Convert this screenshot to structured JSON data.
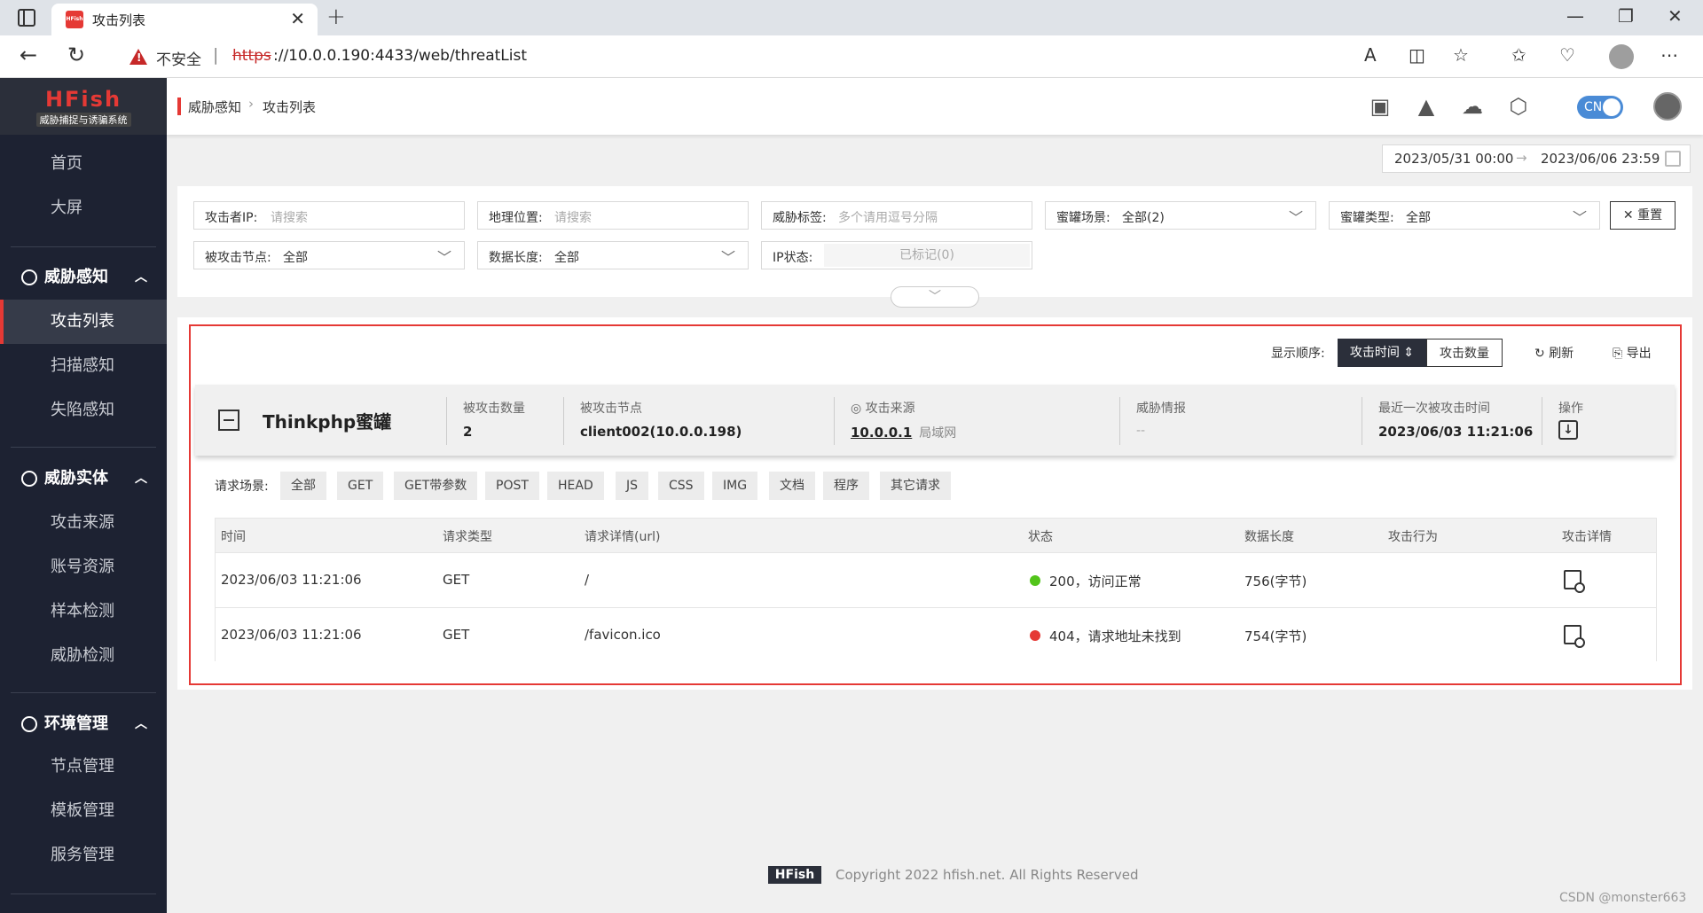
{
  "browser": {
    "tab_title": "攻击列表",
    "tab_favicon_text": "HFish",
    "insecure_label": "不安全",
    "url_proto": "https",
    "url_rest": "://10.0.0.190:4433/web/threatList"
  },
  "sidebar": {
    "logo": "HFish",
    "logo_sub": "威胁捕捉与诱骗系统",
    "top_items": [
      "首页",
      "大屏"
    ],
    "groups": [
      {
        "label": "威胁感知",
        "items": [
          "攻击列表",
          "扫描感知",
          "失陷感知"
        ]
      },
      {
        "label": "威胁实体",
        "items": [
          "攻击来源",
          "账号资源",
          "样本检测",
          "威胁检测"
        ]
      },
      {
        "label": "环境管理",
        "items": [
          "节点管理",
          "模板管理",
          "服务管理"
        ]
      }
    ],
    "active_item": "攻击列表"
  },
  "header": {
    "breadcrumb_parent": "威胁感知",
    "breadcrumb_current": "攻击列表",
    "lang": "CN"
  },
  "daterange": {
    "start": "2023/05/31 00:00",
    "end": "2023/06/06 23:59"
  },
  "filters": {
    "attacker_ip": {
      "label": "攻击者IP:",
      "placeholder": "请搜索"
    },
    "location": {
      "label": "地理位置:",
      "placeholder": "请搜索"
    },
    "threat_tag": {
      "label": "威胁标签:",
      "placeholder": "多个请用逗号分隔"
    },
    "scene": {
      "label": "蜜罐场景:",
      "value": "全部(2)"
    },
    "honeypot_type": {
      "label": "蜜罐类型:",
      "value": "全部"
    },
    "node": {
      "label": "被攻击节点:",
      "value": "全部"
    },
    "data_length": {
      "label": "数据长度:",
      "value": "全部"
    },
    "ip_status": {
      "label": "IP状态:",
      "value": "已标记(0)"
    },
    "reset_label": "重置"
  },
  "result": {
    "sort_label": "显示顺序:",
    "sort_active": "攻击时间",
    "sort_other": "攻击数量",
    "refresh": "刷新",
    "export": "导出",
    "honeypot": {
      "name": "Thinkphp蜜罐",
      "count_label": "被攻击数量",
      "count": "2",
      "node_label": "被攻击节点",
      "node": "client002(10.0.0.198)",
      "source_label": "攻击来源",
      "source_ip": "10.0.0.1",
      "source_net": "局域网",
      "intel_label": "威胁情报",
      "intel": "--",
      "last_label": "最近一次被攻击时间",
      "last": "2023/06/03 11:21:06",
      "op_label": "操作"
    },
    "req_label": "请求场景:",
    "req_tags": [
      "全部",
      "GET",
      "GET带参数",
      "POST",
      "HEAD",
      "JS",
      "CSS",
      "IMG",
      "文档",
      "程序",
      "其它请求"
    ],
    "columns": [
      "时间",
      "请求类型",
      "请求详情(url)",
      "状态",
      "数据长度",
      "攻击行为",
      "攻击详情"
    ],
    "rows": [
      {
        "time": "2023/06/03 11:21:06",
        "method": "GET",
        "url": "/",
        "status": "200，访问正常",
        "status_color": "#52c41a",
        "length": "756(字节)"
      },
      {
        "time": "2023/06/03 11:21:06",
        "method": "GET",
        "url": "/favicon.ico",
        "status": "404，请求地址未找到",
        "status_color": "#e53935",
        "length": "754(字节)"
      }
    ]
  },
  "footer": {
    "badge": "HFish",
    "copyright": "Copyright 2022 hfish.net. All Rights Reserved",
    "watermark": "CSDN @monster663"
  }
}
